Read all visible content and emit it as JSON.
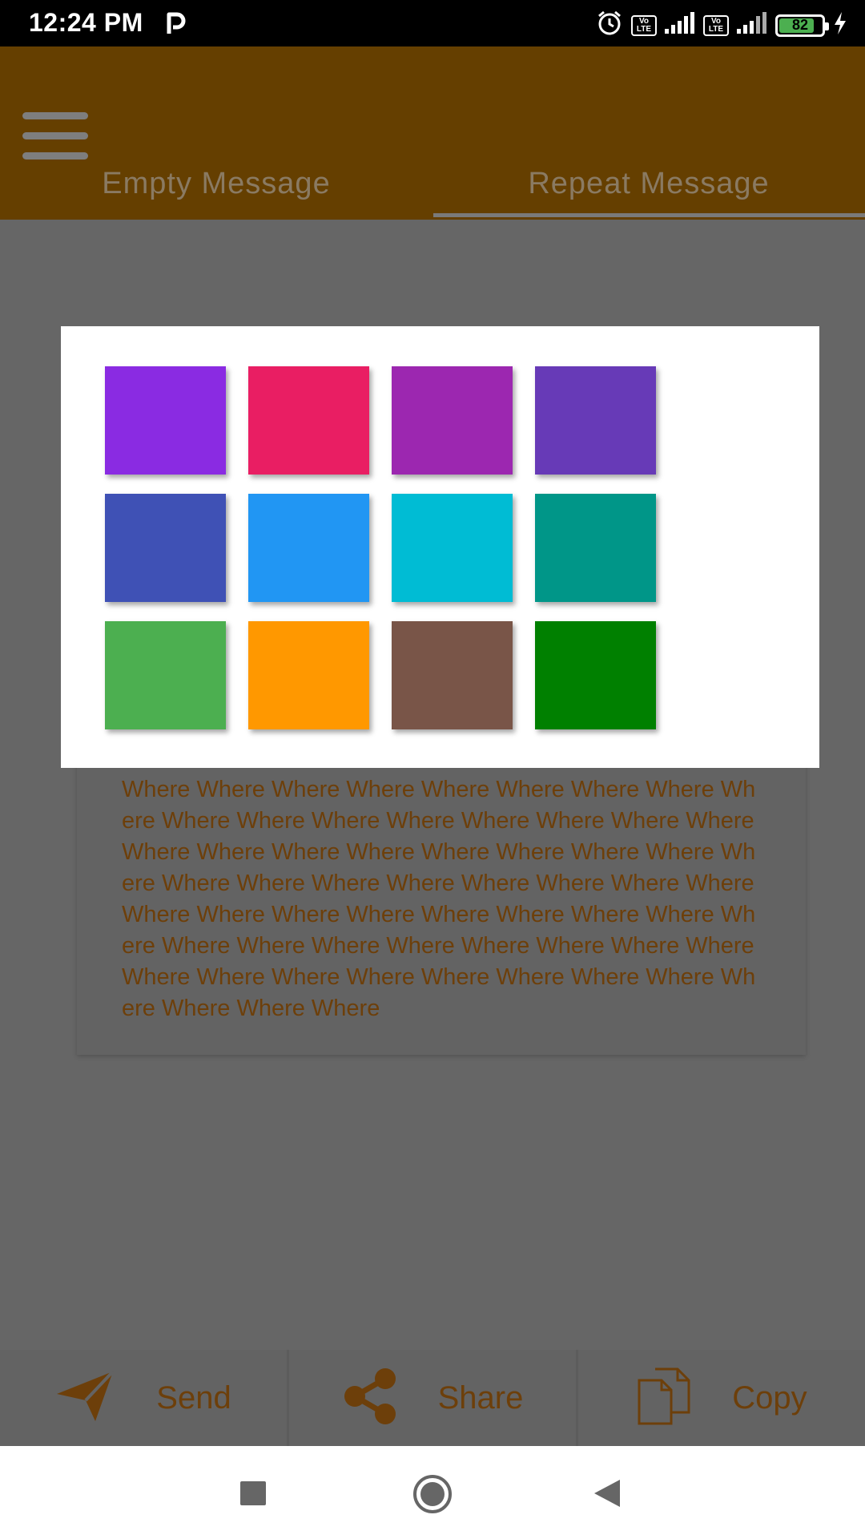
{
  "status_bar": {
    "time": "12:24 PM",
    "volte_top": "Vo",
    "volte_bottom": "LTE",
    "battery_level": "82",
    "battery_fraction": 0.82
  },
  "app_bar": {
    "tabs": [
      {
        "label": "Empty Message",
        "selected": false
      },
      {
        "label": "Repeat Message",
        "selected": true
      }
    ]
  },
  "message": {
    "text": "Where Where Where Where Where Where Where Where Where Where Where Where Where Where Where Where Where Where Where Where Where Where Where Where Where Where Where Where Where Where Where Where Where Where Where Where Where Where Where Where Where Where Where Where Where Where Where Where Where Where Where Where Where Where Where Where Where Where Where Where Where Where Where Where Where Where Where Where Where Where Where Where Where Where Where Where Where Where Where Where "
  },
  "actions": [
    {
      "name": "send",
      "label": "Send",
      "icon": "send-icon"
    },
    {
      "name": "share",
      "label": "Share",
      "icon": "share-icon"
    },
    {
      "name": "copy",
      "label": "Copy",
      "icon": "copy-icon"
    }
  ],
  "color_picker": {
    "colors": [
      "#8a2be2",
      "#e91e63",
      "#9c27b0",
      "#673ab7",
      "#3f51b5",
      "#2196f3",
      "#00bcd4",
      "#009688",
      "#4caf50",
      "#ff9800",
      "#795548",
      "#008000"
    ]
  },
  "theme": {
    "primary": "#653f00",
    "accent_text": "#6d3f0a",
    "scrim": "#666666"
  }
}
